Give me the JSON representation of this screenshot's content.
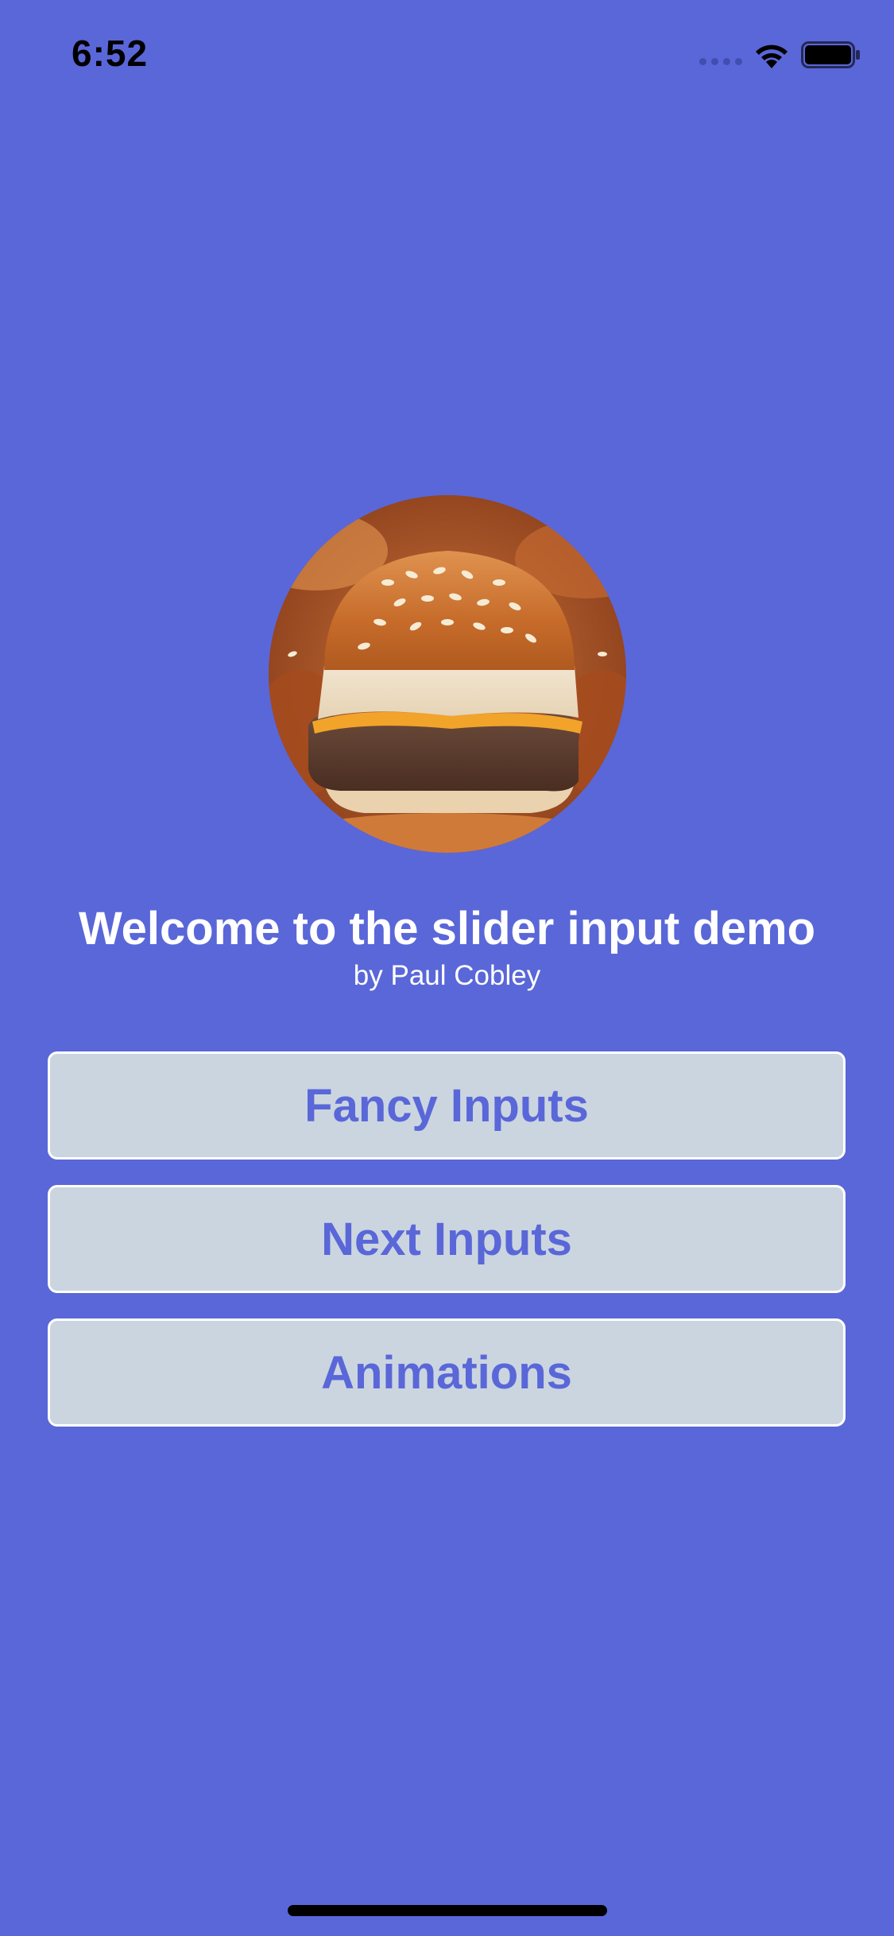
{
  "status_bar": {
    "time": "6:52",
    "wifi_icon": "wifi-icon",
    "battery_icon": "battery-icon"
  },
  "hero": {
    "image_icon": "burger-photo"
  },
  "welcome": {
    "title": "Welcome to the slider input demo",
    "subtitle": "by Paul Cobley"
  },
  "menu": {
    "items": [
      {
        "label": "Fancy Inputs"
      },
      {
        "label": "Next Inputs"
      },
      {
        "label": "Animations"
      }
    ]
  },
  "colors": {
    "background": "#5a67d8",
    "button_bg": "#cbd5e0",
    "button_text": "#5a67d8",
    "title_text": "#ffffff"
  }
}
